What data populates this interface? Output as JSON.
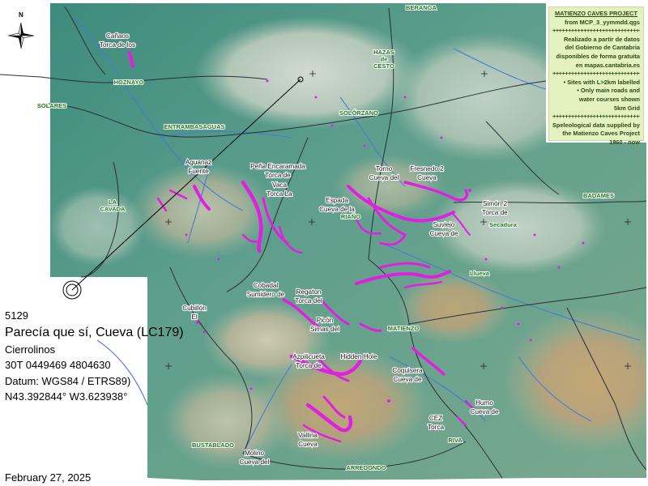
{
  "legend": {
    "title": "MATIENZO CAVES PROJECT",
    "lines": [
      "from MCP_3_yymmdd.qgs",
      "++++++++++++++++++++++++++++++",
      "Realizado a partir de datos",
      "del Gobierno de Cantabria",
      "disponibles de forma gratuita",
      "en mapas.cantabria.es",
      "++++++++++++++++++++++++++++++",
      "• Sites with L>2km labelled",
      "• Only main roads and",
      "water courses shown",
      "5km Grid",
      "++++++++++++++++++++++++++++++",
      "Speleological data supplied by",
      "the Matienzo Caves Project",
      "1960 - now"
    ]
  },
  "north_label": "N",
  "info": {
    "site_number": "5129",
    "site_name": "Parecía que sí, Cueva (LC179)",
    "area": "Cierrolinos",
    "utm": "30T 0449469 4804630",
    "datum": "Datum: WGS84 / ETRS89)",
    "latlon": "N43.392844°  W3.623938°"
  },
  "date": "February 27, 2025",
  "towns": [
    {
      "name": "BERANGA"
    },
    {
      "name": "HAZAS de CESTO",
      "lines": [
        "HAZAS",
        "de",
        "CESTO"
      ]
    },
    {
      "name": "HOZNAYO"
    },
    {
      "name": "SOLARES"
    },
    {
      "name": "SOLÓRZANO"
    },
    {
      "name": "ENTRAMBASAGUAS"
    },
    {
      "name": "LA CAVADA",
      "lines": [
        "LA",
        "CAVADA"
      ]
    },
    {
      "name": "RIAÑO"
    },
    {
      "name": "BADAMES"
    },
    {
      "name": "Secadura"
    },
    {
      "name": "Llueva"
    },
    {
      "name": "MATIENZO"
    },
    {
      "name": "BUSTABLADO"
    },
    {
      "name": "RIVA"
    },
    {
      "name": "ARREDONDO"
    }
  ],
  "caves": [
    {
      "lines": [
        "Cañaos",
        "Torca de los"
      ]
    },
    {
      "lines": [
        "Aguanaz",
        "Fuente"
      ]
    },
    {
      "lines": [
        "Peña Encaramada",
        "Torca de"
      ]
    },
    {
      "lines": [
        "Vaca",
        "Torca La"
      ]
    },
    {
      "lines": [
        "Torno",
        "Cueva del"
      ]
    },
    {
      "lines": [
        "Fresnedo 2",
        "Cueva"
      ]
    },
    {
      "lines": [
        "Espada",
        "Cueva de la"
      ]
    },
    {
      "lines": [
        "Simón 2",
        "Torca de"
      ]
    },
    {
      "lines": [
        "Suviejo",
        "Cueva de"
      ]
    },
    {
      "lines": [
        "Cobadal",
        "Sumidero de"
      ]
    },
    {
      "lines": [
        "Regaton",
        "Torca del"
      ]
    },
    {
      "lines": [
        "Cubillón",
        "El"
      ]
    },
    {
      "lines": [
        "Picón",
        "Simas del"
      ]
    },
    {
      "lines": [
        "Azpilicueta",
        "Torca de"
      ]
    },
    {
      "lines": [
        "Hidden Hole"
      ]
    },
    {
      "lines": [
        "Coquisera",
        "Cueva de"
      ]
    },
    {
      "lines": [
        "Humo",
        "Cueva de"
      ]
    },
    {
      "lines": [
        "CEZ",
        "Torca"
      ]
    },
    {
      "lines": [
        "Vallina",
        "Cueva"
      ]
    },
    {
      "lines": [
        "Molino",
        "Cueva del"
      ]
    }
  ],
  "colors": {
    "cave_passage": "#e020e0",
    "town_label": "#1a7a1a",
    "road": "#2a2f38",
    "river": "#4a7bd0",
    "terrain_low": "#3f8f86",
    "terrain_high": "#c8b592"
  }
}
